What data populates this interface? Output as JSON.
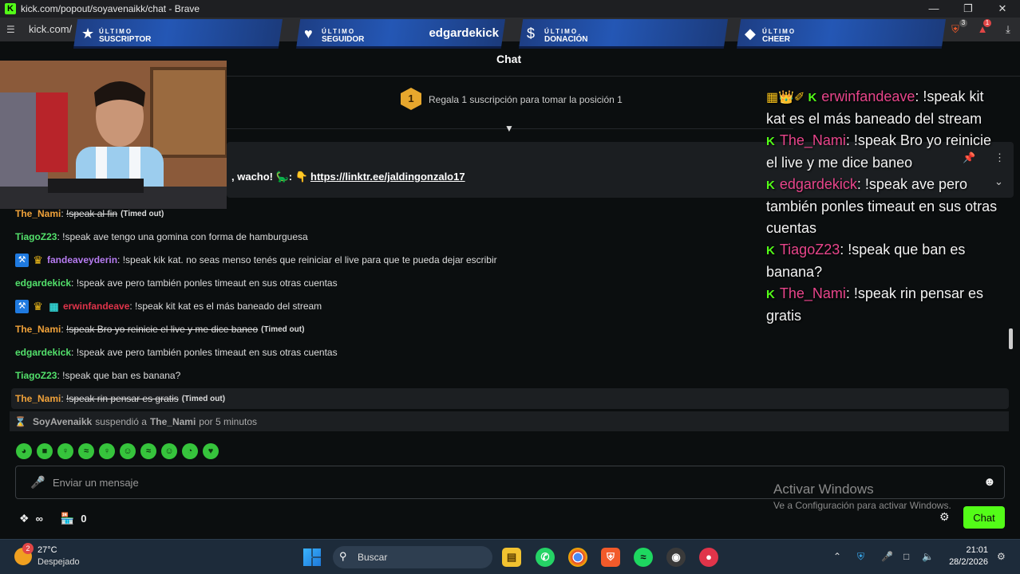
{
  "window": {
    "title": "kick.com/popout/soyavenaikk/chat - Brave",
    "url": "kick.com/",
    "logo_letter": "K",
    "minimize": "—",
    "maximize": "❐",
    "close": "✕"
  },
  "extensions": {
    "brave_shield_count": "3",
    "rewards_count": "1"
  },
  "overlay_banners": [
    {
      "icon": "★",
      "line1": "ÚLTIMO",
      "line2": "SUSCRIPTOR",
      "name": ""
    },
    {
      "icon": "♥",
      "line1": "ÚLTIMO",
      "line2": "SEGUIDOR",
      "name": "edgardekick"
    },
    {
      "icon": "$",
      "line1": "ÚLTIMO",
      "line2": "DONACIÓN",
      "name": ""
    },
    {
      "icon": "◆",
      "line1": "ÚLTIMO",
      "line2": "CHEER",
      "name": ""
    }
  ],
  "chat_header": {
    "title": "Chat"
  },
  "sub_goal": {
    "position": "1",
    "text": "Regala 1 suscripción para tomar la posición 1"
  },
  "pinned": {
    "text": ", wacho! 🦕: 👇",
    "link": "https://linktr.ee/jaldingonzalo17"
  },
  "messages": [
    {
      "badges": [],
      "user": "The_Nami",
      "color": "#f0a23a",
      "text": "!speak al fin",
      "struck": true,
      "timeout": "(Timed out)"
    },
    {
      "badges": [],
      "user": "TiagoZ23",
      "color": "#53e06b",
      "text": "!speak ave tengo una gomina con forma de hamburguesa",
      "struck": false,
      "timeout": ""
    },
    {
      "badges": [
        "mod",
        "vip"
      ],
      "user": "fandeaveyderin",
      "color": "#b77cf2",
      "text": "!speak kik kat. no seas menso tenés que reiniciar el live para que te pueda dejar escribir",
      "struck": false,
      "timeout": ""
    },
    {
      "badges": [],
      "user": "edgardekick",
      "color": "#53e06b",
      "text": "!speak ave pero también ponles timeaut en sus otras cuentas",
      "struck": false,
      "timeout": ""
    },
    {
      "badges": [
        "mod",
        "vip",
        "og"
      ],
      "user": "erwinfandeave",
      "color": "#e0344a",
      "text": "!speak kit kat es el más baneado del stream",
      "struck": false,
      "timeout": ""
    },
    {
      "badges": [],
      "user": "The_Nami",
      "color": "#f0a23a",
      "text": "!speak Bro yo reinicie el live y me dice baneo",
      "struck": true,
      "timeout": "(Timed out)"
    },
    {
      "badges": [],
      "user": "edgardekick",
      "color": "#53e06b",
      "text": "!speak ave pero también ponles timeaut en sus otras cuentas",
      "struck": false,
      "timeout": ""
    },
    {
      "badges": [],
      "user": "TiagoZ23",
      "color": "#53e06b",
      "text": "!speak que ban es banana?",
      "struck": false,
      "timeout": ""
    },
    {
      "badges": [],
      "user": "The_Nami",
      "color": "#f0a23a",
      "text": "!speak rin pensar es gratis",
      "struck": true,
      "timeout": "(Timed out)"
    }
  ],
  "system_message": {
    "actor": "SoyAvenaikk",
    "action": "suspendió a",
    "target": "The_Nami",
    "duration": "por 5 minutos"
  },
  "emotes": [
    "◕",
    "■",
    "♀",
    "≈",
    "♀",
    "☺",
    "≈",
    "☺",
    "◔",
    "♥"
  ],
  "composer": {
    "placeholder": "Enviar un mensaje"
  },
  "windows_watermark": {
    "title": "Activar Windows",
    "subtitle": "Ve a Configuración para activar Windows."
  },
  "footer": {
    "points_symbol": "∞",
    "store_count": "0",
    "chat_button": "Chat"
  },
  "stream_overlay_chat": [
    {
      "prefix": "▦👑✐",
      "user": "erwinfandeave",
      "text": "!speak kit kat es el más baneado del stream"
    },
    {
      "prefix": "",
      "user": "The_Nami",
      "text": "!speak Bro yo reinicie el live y me dice baneo"
    },
    {
      "prefix": "",
      "user": "edgardekick",
      "text": "!speak ave pero también ponles timeaut en sus otras cuentas"
    },
    {
      "prefix": "",
      "user": "TiagoZ23",
      "text": "!speak que ban es banana?"
    },
    {
      "prefix": "",
      "user": "The_Nami",
      "text": "!speak rin pensar es gratis"
    }
  ],
  "taskbar": {
    "weather_badge": "2",
    "temperature": "27°C",
    "condition": "Despejado",
    "search_label": "Buscar",
    "time": "21:01",
    "date": "28/2/2026"
  },
  "colors": {
    "kick_green": "#53fc18",
    "banner_blue": "#2457b5"
  }
}
